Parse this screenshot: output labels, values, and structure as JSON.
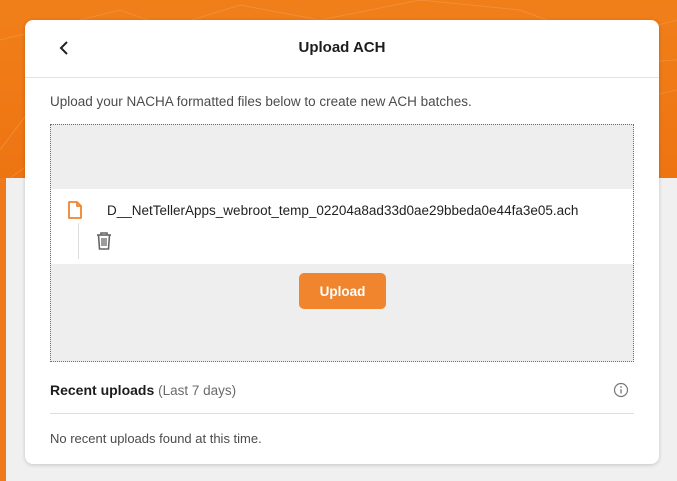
{
  "page": {
    "title": "Upload ACH",
    "intro_text": "Upload your NACHA formatted files below to create new ACH batches."
  },
  "dropzone": {
    "file_name": "D__NetTellerApps_webroot_temp_02204a8ad33d0ae29bbeda0e44fa3e05.ach",
    "upload_label": "Upload"
  },
  "recent": {
    "title": "Recent uploads",
    "subtitle": "(Last 7 days)",
    "empty_message": "No recent uploads found at this time."
  },
  "icons": {
    "back": "chevron-left-icon",
    "file": "file-icon",
    "trash": "trash-icon",
    "info": "info-icon"
  },
  "colors": {
    "brand_orange": "#f0852d",
    "background_orange": "#ee7412",
    "background_gray": "#f1f0f0"
  }
}
